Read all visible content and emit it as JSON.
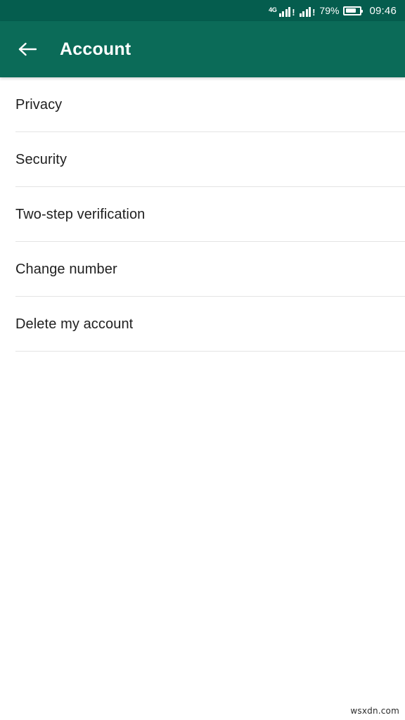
{
  "status_bar": {
    "network_label": "4G",
    "signal_alert": "!",
    "battery_percent": "79%",
    "battery_level": 75,
    "clock": "09:46",
    "background_color": "#055d4e"
  },
  "app_bar": {
    "back_label": "Back",
    "title": "Account",
    "background_color": "#0b6b58",
    "text_color": "#ffffff"
  },
  "settings_list": {
    "divider_color": "#e4e4e4",
    "items": [
      {
        "label": "Privacy"
      },
      {
        "label": "Security"
      },
      {
        "label": "Two-step verification"
      },
      {
        "label": "Change number"
      },
      {
        "label": "Delete my account"
      }
    ]
  },
  "watermark": {
    "text": "wsxdn.com"
  }
}
